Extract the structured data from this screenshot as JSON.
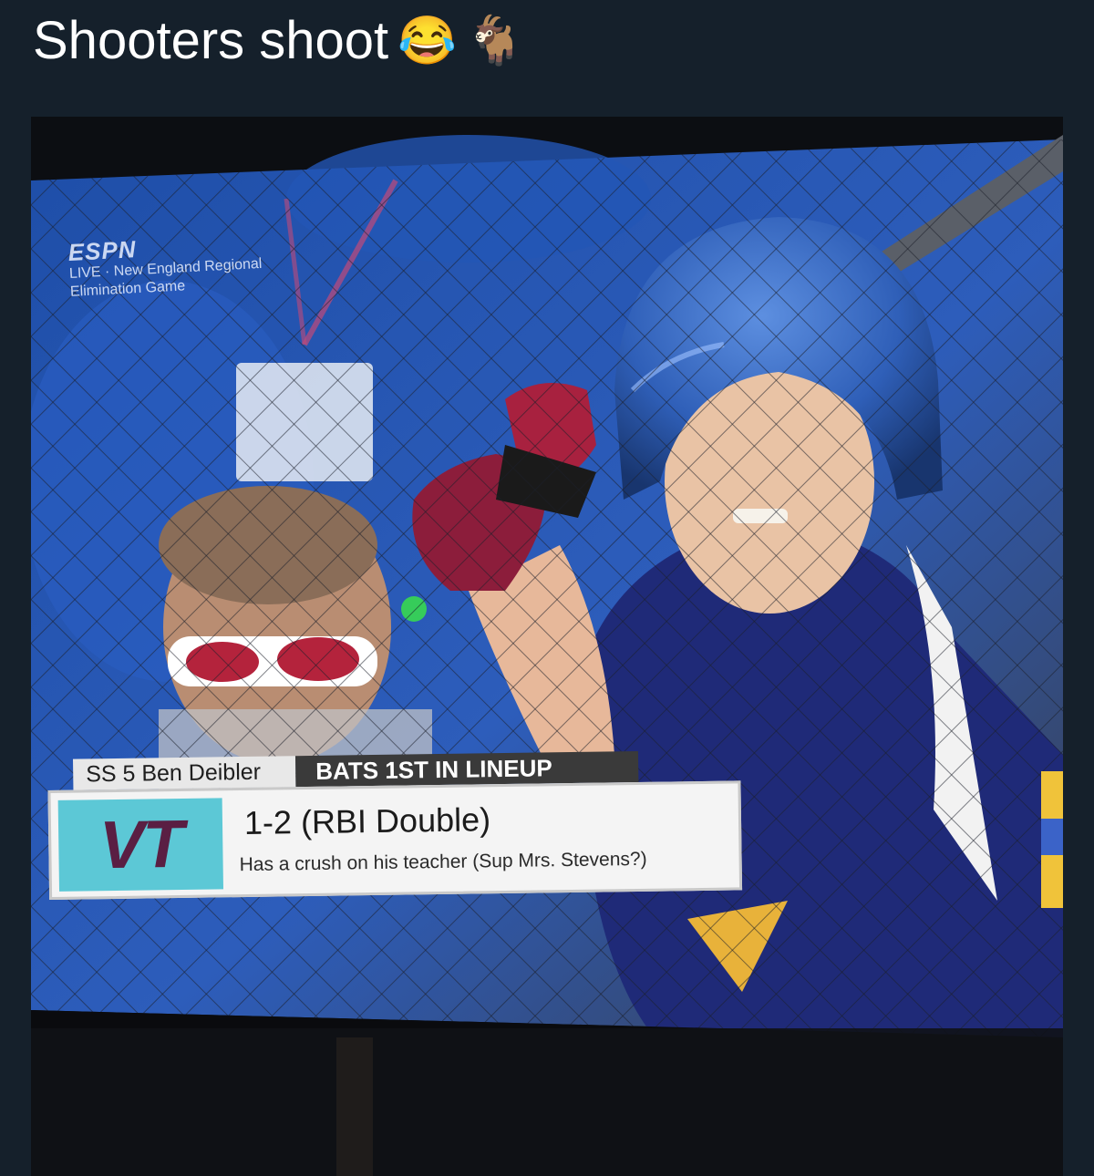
{
  "post": {
    "caption": "Shooters shoot",
    "emojis": [
      "😂",
      "🐐"
    ]
  },
  "broadcast": {
    "network": "ESPN",
    "live_line": "LIVE · New England Regional",
    "game_line": "Elimination Game",
    "player": "SS 5 Ben Deibler",
    "lineup_tag": "BATS 1ST IN LINEUP",
    "team": "VT",
    "stat_line": "1-2 (RBI Double)",
    "note": "Has a crush on his teacher (Sup Mrs. Stevens?)"
  },
  "colors": {
    "background": "#15202b",
    "team_box": "#5cc8d6",
    "team_text": "#5a1f43",
    "helmet": "#2f5fb8",
    "jersey": "#1f2a78"
  }
}
